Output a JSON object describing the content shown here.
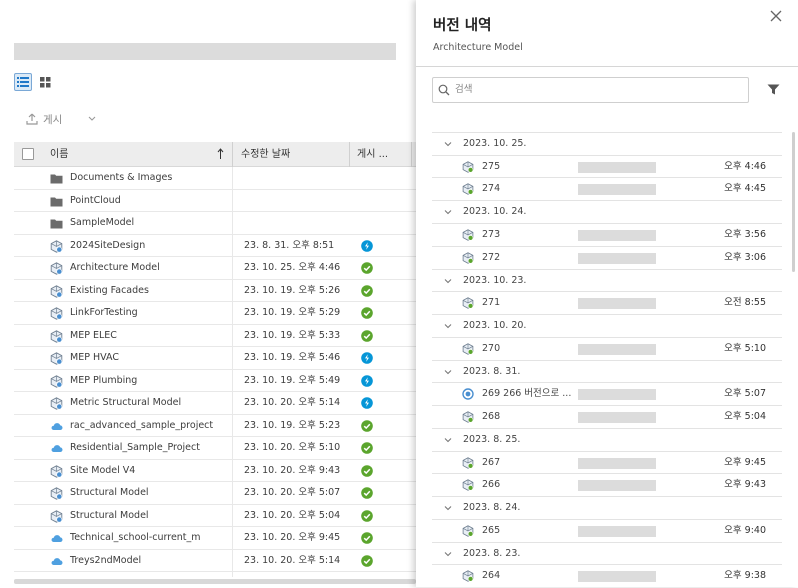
{
  "toolbar": {
    "publish_label": "게시"
  },
  "table": {
    "headers": {
      "name": "이름",
      "modified": "수정한 날짜",
      "publish": "게시 ..."
    },
    "rows": [
      {
        "name": "Documents & Images",
        "date": "",
        "type": "folder",
        "status": ""
      },
      {
        "name": "PointCloud",
        "date": "",
        "type": "folder",
        "status": ""
      },
      {
        "name": "SampleModel",
        "date": "",
        "type": "folder",
        "status": ""
      },
      {
        "name": "2024SiteDesign",
        "date": "23. 8. 31. 오후 8:51",
        "type": "revit",
        "status": "blue"
      },
      {
        "name": "Architecture Model",
        "date": "23. 10. 25. 오후 4:46",
        "type": "revit",
        "status": "green"
      },
      {
        "name": "Existing Facades",
        "date": "23. 10. 19. 오후 5:26",
        "type": "revit",
        "status": "green"
      },
      {
        "name": "LinkForTesting",
        "date": "23. 10. 19. 오후 5:29",
        "type": "revit",
        "status": "green"
      },
      {
        "name": "MEP ELEC",
        "date": "23. 10. 19. 오후 5:33",
        "type": "revit",
        "status": "green"
      },
      {
        "name": "MEP HVAC",
        "date": "23. 10. 19. 오후 5:46",
        "type": "revit",
        "status": "blue"
      },
      {
        "name": "MEP Plumbing",
        "date": "23. 10. 19. 오후 5:49",
        "type": "revit",
        "status": "blue"
      },
      {
        "name": "Metric Structural Model",
        "date": "23. 10. 20. 오후 5:14",
        "type": "revit",
        "status": "blue"
      },
      {
        "name": "rac_advanced_sample_project",
        "date": "23. 10. 19. 오후 5:23",
        "type": "cloud",
        "status": "green"
      },
      {
        "name": "Residential_Sample_Project",
        "date": "23. 10. 20. 오후 5:10",
        "type": "cloud",
        "status": "green"
      },
      {
        "name": "Site Model V4",
        "date": "23. 10. 20. 오후 9:43",
        "type": "revit",
        "status": "green"
      },
      {
        "name": "Structural Model",
        "date": "23. 10. 20. 오후 5:07",
        "type": "revit",
        "status": "green"
      },
      {
        "name": "Structural Model",
        "date": "23. 10. 20. 오후 5:04",
        "type": "revit",
        "status": "green"
      },
      {
        "name": "Technical_school-current_m",
        "date": "23. 10. 20. 오후 9:45",
        "type": "cloud",
        "status": "green"
      },
      {
        "name": "Treys2ndModel",
        "date": "23. 10. 20. 오후 5:14",
        "type": "cloud",
        "status": "green"
      }
    ]
  },
  "panel": {
    "title": "버전 내역",
    "subtitle": "Architecture Model",
    "search_placeholder": "검색",
    "groups": [
      {
        "date": "2023. 10. 25.",
        "versions": [
          {
            "num": "275",
            "time": "오후 4:46",
            "icon": "revit"
          },
          {
            "num": "274",
            "time": "오후 4:45",
            "icon": "revit"
          }
        ]
      },
      {
        "date": "2023. 10. 24.",
        "versions": [
          {
            "num": "273",
            "time": "오후 3:56",
            "icon": "revit"
          },
          {
            "num": "272",
            "time": "오후 3:06",
            "icon": "revit"
          }
        ]
      },
      {
        "date": "2023. 10. 23.",
        "versions": [
          {
            "num": "271",
            "time": "오전 8:55",
            "icon": "revit"
          }
        ]
      },
      {
        "date": "2023. 10. 20.",
        "versions": [
          {
            "num": "270",
            "time": "오후 5:10",
            "icon": "revit"
          }
        ]
      },
      {
        "date": "2023. 8. 31.",
        "versions": [
          {
            "num": "269 266 버전으로 ...",
            "time": "오후 5:07",
            "icon": "restore"
          },
          {
            "num": "268",
            "time": "오후 5:04",
            "icon": "revit"
          }
        ]
      },
      {
        "date": "2023. 8. 25.",
        "versions": [
          {
            "num": "267",
            "time": "오후 9:45",
            "icon": "revit"
          },
          {
            "num": "266",
            "time": "오후 9:43",
            "icon": "revit"
          }
        ]
      },
      {
        "date": "2023. 8. 24.",
        "versions": [
          {
            "num": "265",
            "time": "오후 9:40",
            "icon": "revit"
          }
        ]
      },
      {
        "date": "2023. 8. 23.",
        "versions": [
          {
            "num": "264",
            "time": "오후 9:38",
            "icon": "revit"
          }
        ]
      }
    ]
  },
  "colors": {
    "accent_blue": "#0696d7",
    "status_green": "#5ba52d",
    "folder_gray": "#6b6b6b"
  },
  "icons": {
    "list_view": "list-view-icon",
    "grid_view": "grid-view-icon",
    "upload": "upload-icon",
    "sort": "sort-arrow-icon",
    "close": "close-icon",
    "search": "search-icon",
    "filter": "filter-icon"
  }
}
